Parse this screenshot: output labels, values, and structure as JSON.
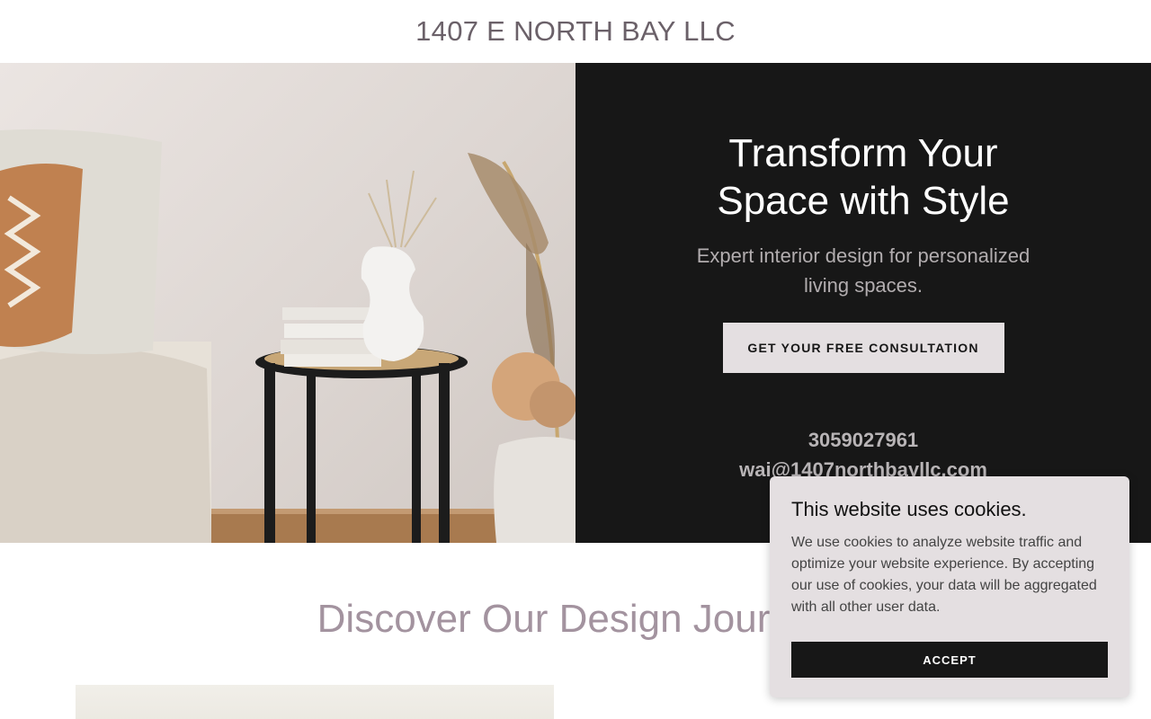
{
  "header": {
    "title": "1407 E NORTH BAY LLC"
  },
  "hero": {
    "heading": "Transform Your Space with Style",
    "subheading": "Expert interior design for personalized living spaces.",
    "cta_label": "GET YOUR FREE CONSULTATION",
    "phone": "3059027961",
    "email": "wai@1407northbayllc.com"
  },
  "section": {
    "heading": "Discover Our Design Journey"
  },
  "cookie": {
    "title": "This website uses cookies.",
    "body": "We use cookies to analyze website traffic and optimize your website experience. By accepting our use of cookies, your data will be aggregated with all other user data.",
    "accept_label": "ACCEPT"
  },
  "colors": {
    "dark": "#171717",
    "button_light": "#e4dfe1",
    "heading_mauve": "#a3939f"
  }
}
